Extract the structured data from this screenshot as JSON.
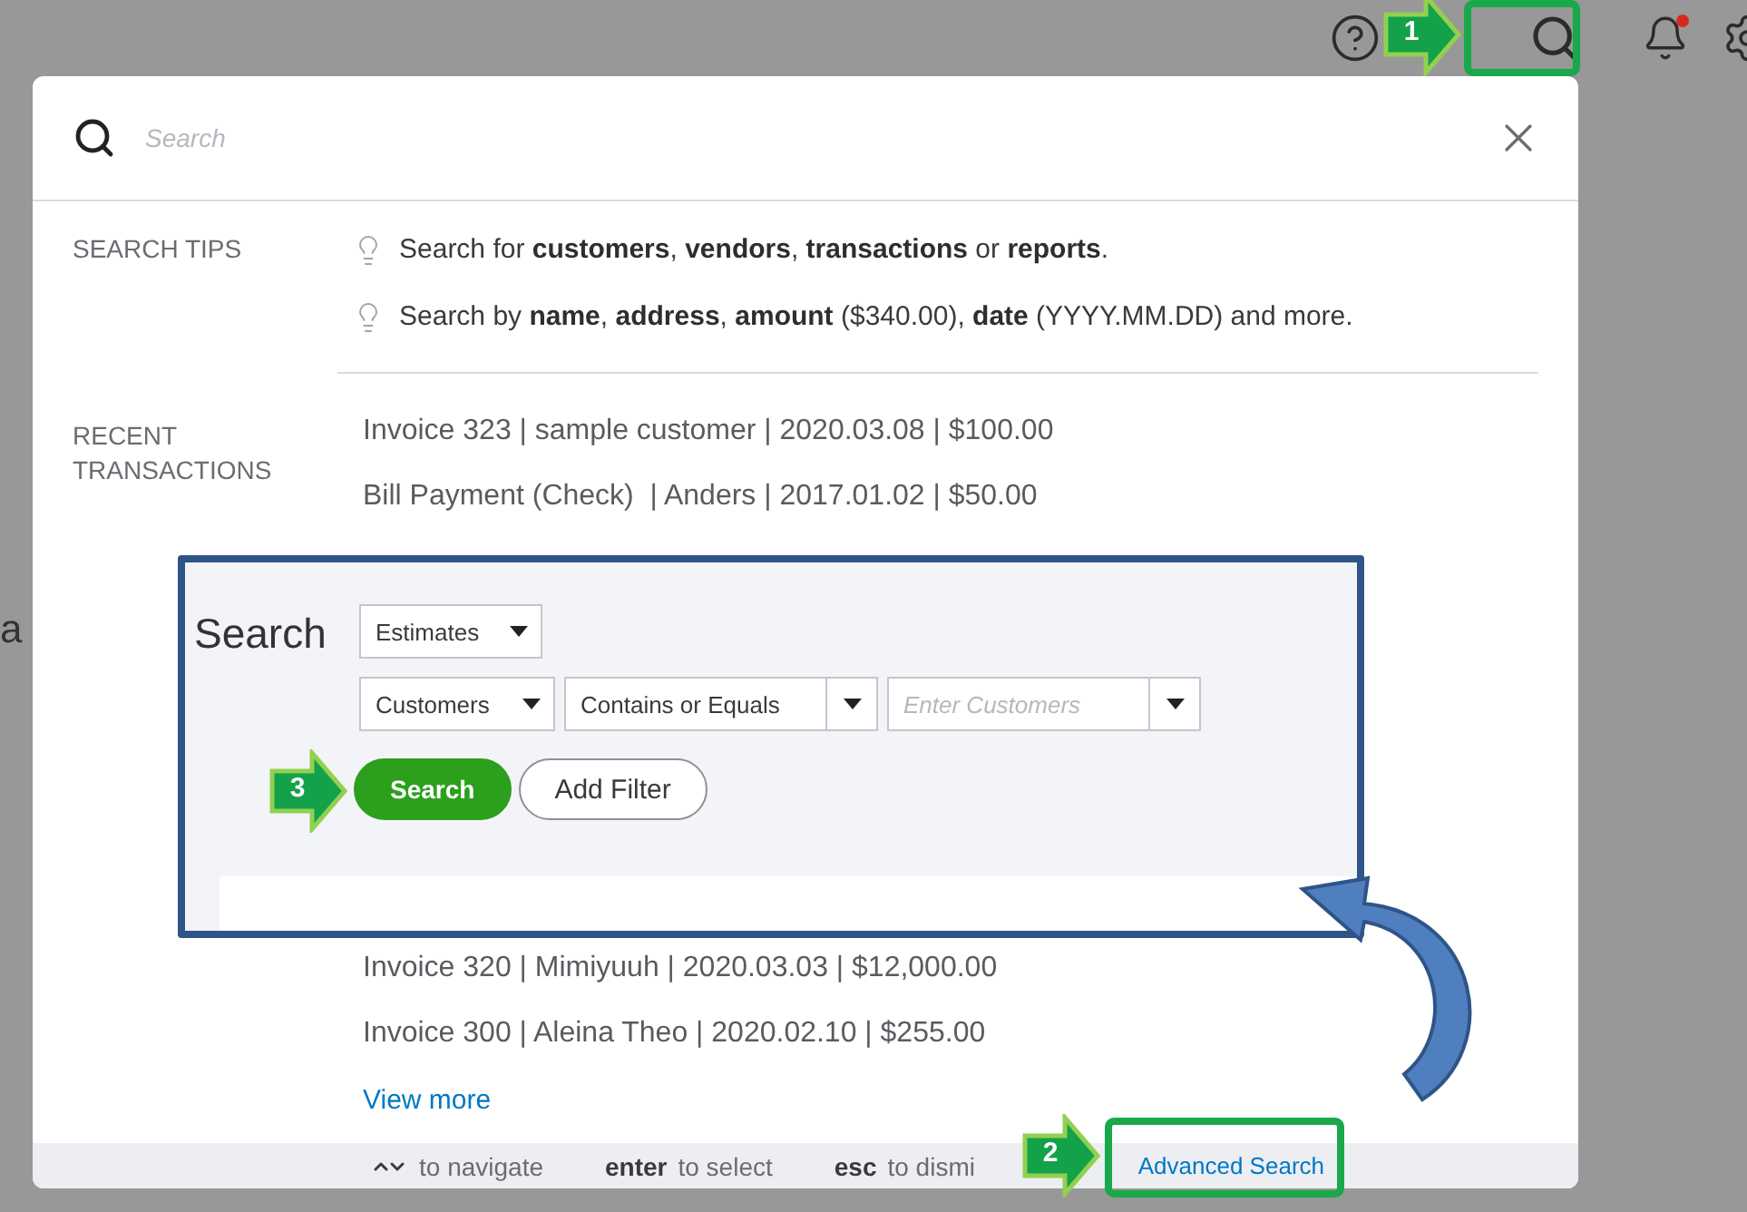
{
  "top_bar": {
    "notifications": {
      "unread": true
    }
  },
  "background_text": "a",
  "search_dialog": {
    "search": {
      "placeholder": "Search"
    },
    "tips_label": "SEARCH TIPS",
    "tips": [
      "Search for **customers**, **vendors**, **transactions** or **reports**.",
      "Search by **name**, **address**, **amount** ($340.00), **date** (YYYY.MM.DD) and more."
    ],
    "recent_label": "RECENT TRANSACTIONS",
    "recent_top": [
      "Invoice 323 | sample customer | 2020.03.08 | $100.00",
      "Bill Payment (Check)  | Anders | 2017.01.02 | $50.00"
    ],
    "recent_bottom": [
      "Invoice 320 | Mimiyuuh | 2020.03.03 | $12,000.00",
      "Invoice 300 | Aleina Theo | 2020.02.10 | $255.00"
    ],
    "view_more": "View more",
    "footer": [
      {
        "kind": "icon",
        "text": "to navigate"
      },
      {
        "kind": "key",
        "key": "enter",
        "text": "to select"
      },
      {
        "kind": "key",
        "key": "esc",
        "text": "to dismi"
      }
    ],
    "advanced_search": "Advanced Search"
  },
  "advanced_search_panel": {
    "title": "Search",
    "type_select": "Estimates",
    "filter_field": "Customers",
    "operator": "Contains or Equals",
    "value": {
      "placeholder": "Enter Customers"
    },
    "buttons": [
      {
        "label": "Search",
        "primary": true
      },
      {
        "label": "Add Filter",
        "primary": false
      }
    ]
  },
  "callouts": [
    {
      "number": "1"
    },
    {
      "number": "2"
    },
    {
      "number": "3"
    }
  ]
}
